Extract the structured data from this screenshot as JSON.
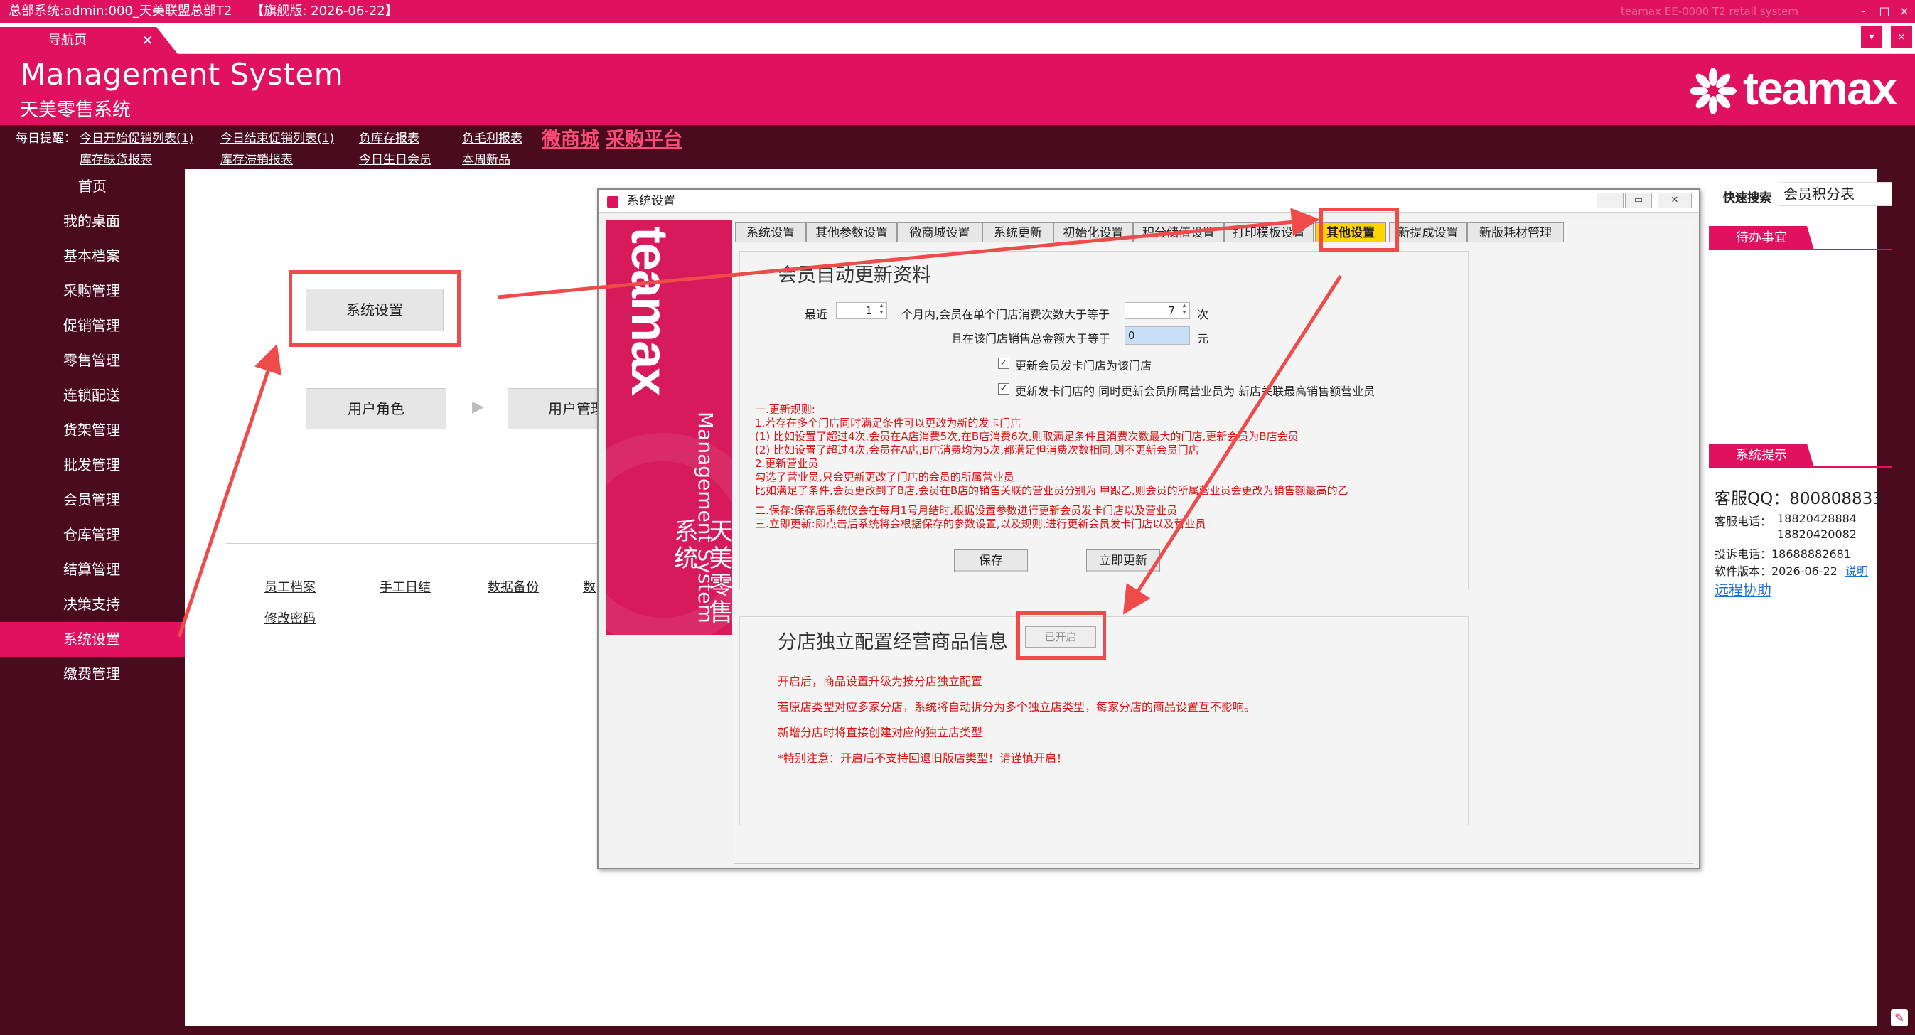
{
  "window": {
    "title": "总部系统:admin:000_天美联盟总部T2　　【旗舰版: 2026-06-22】",
    "controls": [
      "-",
      "□",
      "×"
    ]
  },
  "tabstrip": {
    "tab_label": "导航页",
    "tab_close": "×",
    "dropdown": "▾",
    "close": "×"
  },
  "header": {
    "title": "Management System",
    "subtitle": "天美零售系统",
    "logo_text": "teamax"
  },
  "reminder": {
    "prefix": "每日提醒：",
    "links": [
      "今日开始促销列表(1)",
      "库存缺货报表",
      "今日结束促销列表(1)",
      "库存滞销报表",
      "负库存报表",
      "今日生日会员",
      "负毛利报表",
      "本周新品"
    ],
    "big_links": [
      "微商城",
      "采购平台"
    ]
  },
  "sidebar": {
    "items": [
      "首页",
      "我的桌面",
      "基本档案",
      "采购管理",
      "促销管理",
      "零售管理",
      "连锁配送",
      "货架管理",
      "批发管理",
      "会员管理",
      "仓库管理",
      "结算管理",
      "决策支持",
      "系统设置",
      "缴费管理"
    ],
    "active_index": 13
  },
  "main": {
    "buttons": [
      "系统设置",
      "用户角色",
      "用户管理"
    ],
    "arrow": "▶",
    "links": [
      "员工档案",
      "手工日结",
      "数据备份",
      "数",
      "修改密码"
    ]
  },
  "right_panel": {
    "search_label": "快速搜索",
    "search_value": "会员积分表",
    "todo_label": "待办事宜",
    "tips_label": "系统提示",
    "qq": "客服QQ：800808833",
    "phone_label": "客服电话：",
    "phone1": "18820428884",
    "phone2": "18820420082",
    "complaint": "投诉电话：18688882681",
    "version": "软件版本：2026-06-22",
    "version_link": "说明",
    "remote": "远程协助"
  },
  "dialog": {
    "title": "系统设置",
    "controls": [
      "—",
      "▭",
      "✕"
    ],
    "banner": {
      "logo": "teamax",
      "en": "Management System",
      "cn": "天美零售系统"
    },
    "tabs": [
      "系统设置",
      "其他参数设置",
      "微商城设置",
      "系统更新",
      "初始化设置",
      "积分储值设置",
      "打印模板设置",
      "其他设置",
      "新提成设置",
      "新版耗材管理"
    ],
    "active_tab": 7,
    "member_group": {
      "title": "会员自动更新资料",
      "recent": "最近",
      "months_value": "1",
      "months_text": "个月内,会员在单个门店消费次数大于等于",
      "times_value": "7",
      "times_unit": "次",
      "amount_text": "且在该门店销售总金额大于等于",
      "amount_value": "0",
      "amount_unit": "元",
      "check1": "更新会员发卡门店为该门店",
      "check2": "更新发卡门店的 同时更新会员所属营业员为 新店关联最高销售额营业员",
      "check_mark": "✓",
      "rules": [
        "一.更新规则:",
        "1.若存在多个门店同时满足条件可以更改为新的发卡门店",
        "  (1) 比如设置了超过4次,会员在A店消费5次,在B店消费6次,则取满足条件且消费次数最大的门店,更新会员为B店会员",
        "  (2) 比如设置了超过4次,会员在A店,B店消费均为5次,都满足但消费次数相同,则不更新会员门店",
        "2.更新营业员",
        "  勾选了营业员,只会更新更改了门店的会员的所属营业员",
        "  比如满足了条件,会员更改到了B店,会员在B店的销售关联的营业员分别为 甲跟乙,则会员的所属营业员会更改为销售额最高的乙",
        "",
        "二.保存:保存后系统仅会在每月1号月结时,根据设置参数进行更新会员发卡门店以及营业员",
        "三.立即更新:即点击后系统将会根据保存的参数设置,以及规则,进行更新会员发卡门店以及营业员"
      ],
      "save": "保存",
      "update_now": "立即更新"
    },
    "branch_group": {
      "title": "分店独立配置经营商品信息",
      "toggle": "已开启",
      "notes": [
        "开启后，商品设置升级为按分店独立配置",
        "若原店类型对应多家分店，系统将自动拆分为多个独立店类型，每家分店的商品设置互不影响。",
        "新增分店时将直接创建对应的独立店类型",
        "*特别注意：开启后不支持回退旧版店类型！请谨慎开启！"
      ]
    }
  },
  "watermark": "teamax EE-0000 T2 retail system",
  "colors": {
    "brand": "#e0115f",
    "dark": "#4a0b1f",
    "annotation": "#ef4b4b",
    "active_tab": "#ffd400"
  }
}
